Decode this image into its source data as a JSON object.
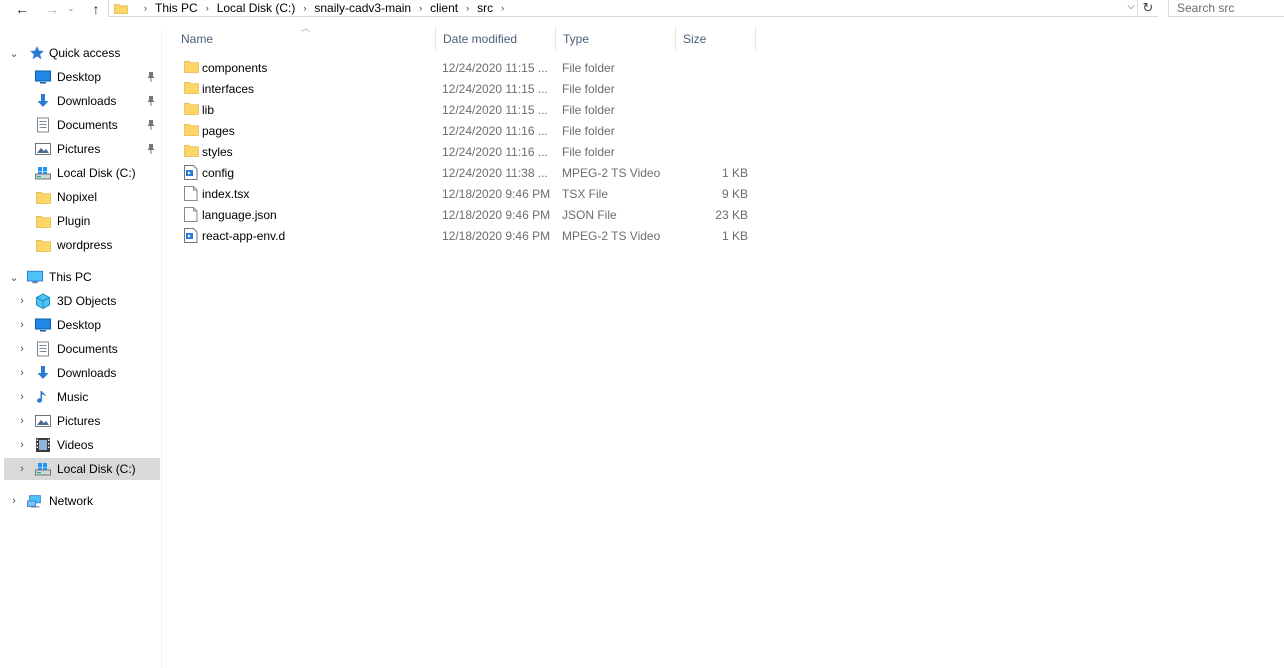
{
  "search": {
    "placeholder": "Search src"
  },
  "address": {
    "crumbs": [
      "This PC",
      "Local Disk (C:)",
      "snaily-cadv3-main",
      "client",
      "src"
    ]
  },
  "nav": {
    "quick_access": "Quick access",
    "pinned": [
      {
        "label": "Desktop",
        "icon": "desktop-icon",
        "pinned": true
      },
      {
        "label": "Downloads",
        "icon": "download-icon",
        "pinned": true
      },
      {
        "label": "Documents",
        "icon": "documents-icon",
        "pinned": true
      },
      {
        "label": "Pictures",
        "icon": "pictures-icon",
        "pinned": true
      },
      {
        "label": "Local Disk (C:)",
        "icon": "drive-icon",
        "pinned": false
      },
      {
        "label": "Nopixel",
        "icon": "folder-icon",
        "pinned": false
      },
      {
        "label": "Plugin",
        "icon": "folder-icon",
        "pinned": false
      },
      {
        "label": "wordpress",
        "icon": "folder-icon",
        "pinned": false
      }
    ],
    "this_pc": "This PC",
    "pc_items": [
      {
        "label": "3D Objects",
        "icon": "cube-icon"
      },
      {
        "label": "Desktop",
        "icon": "desktop-icon"
      },
      {
        "label": "Documents",
        "icon": "documents-icon"
      },
      {
        "label": "Downloads",
        "icon": "download-icon"
      },
      {
        "label": "Music",
        "icon": "music-icon"
      },
      {
        "label": "Pictures",
        "icon": "pictures-icon"
      },
      {
        "label": "Videos",
        "icon": "video-icon"
      },
      {
        "label": "Local Disk (C:)",
        "icon": "drive-icon",
        "selected": true
      }
    ],
    "network": "Network"
  },
  "columns": {
    "name": "Name",
    "date": "Date modified",
    "type": "Type",
    "size": "Size"
  },
  "files": [
    {
      "name": "components",
      "date": "12/24/2020 11:15 ...",
      "type": "File folder",
      "size": "",
      "icon": "folder-icon"
    },
    {
      "name": "interfaces",
      "date": "12/24/2020 11:15 ...",
      "type": "File folder",
      "size": "",
      "icon": "folder-icon"
    },
    {
      "name": "lib",
      "date": "12/24/2020 11:15 ...",
      "type": "File folder",
      "size": "",
      "icon": "folder-icon"
    },
    {
      "name": "pages",
      "date": "12/24/2020 11:16 ...",
      "type": "File folder",
      "size": "",
      "icon": "folder-icon"
    },
    {
      "name": "styles",
      "date": "12/24/2020 11:16 ...",
      "type": "File folder",
      "size": "",
      "icon": "folder-icon"
    },
    {
      "name": "config",
      "date": "12/24/2020 11:38 ...",
      "type": "MPEG-2 TS Video",
      "size": "1 KB",
      "icon": "video-file-icon"
    },
    {
      "name": "index.tsx",
      "date": "12/18/2020 9:46 PM",
      "type": "TSX File",
      "size": "9 KB",
      "icon": "file-icon"
    },
    {
      "name": "language.json",
      "date": "12/18/2020 9:46 PM",
      "type": "JSON File",
      "size": "23 KB",
      "icon": "file-icon"
    },
    {
      "name": "react-app-env.d",
      "date": "12/18/2020 9:46 PM",
      "type": "MPEG-2 TS Video",
      "size": "1 KB",
      "icon": "video-file-icon"
    }
  ]
}
